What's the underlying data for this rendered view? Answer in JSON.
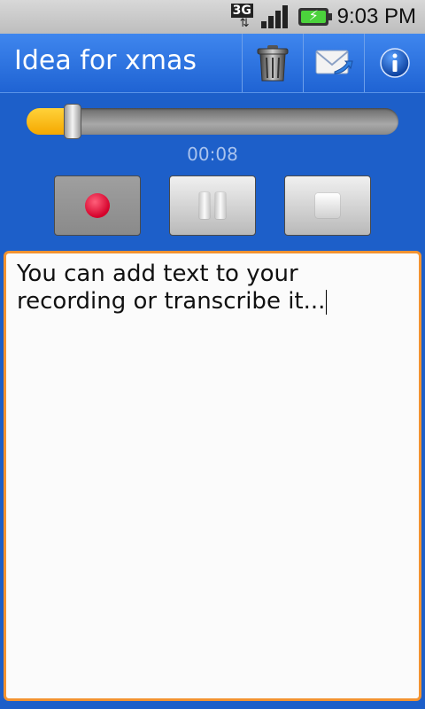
{
  "status_bar": {
    "network": "3G",
    "time": "9:03 PM"
  },
  "title_bar": {
    "title": "Idea for xmas",
    "actions": [
      {
        "name": "delete",
        "icon": "trash-icon"
      },
      {
        "name": "send",
        "icon": "mail-icon"
      },
      {
        "name": "info",
        "icon": "info-icon"
      }
    ]
  },
  "player": {
    "progress": 0.1,
    "elapsed": "00:08",
    "controls": [
      {
        "name": "record",
        "icon": "record-icon",
        "active": true
      },
      {
        "name": "pause",
        "icon": "pause-icon",
        "active": false
      },
      {
        "name": "stop",
        "icon": "stop-icon",
        "active": false
      }
    ]
  },
  "note": {
    "text": "You can add text to your recording or transcribe it..."
  },
  "colors": {
    "background": "#1d5fc9",
    "accent": "#f39331",
    "slider_fill": "#f5a800",
    "record": "#d4002a"
  }
}
